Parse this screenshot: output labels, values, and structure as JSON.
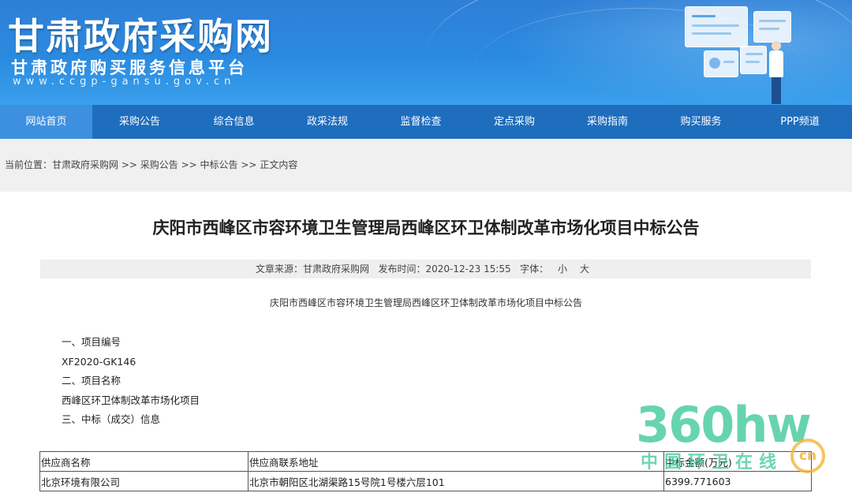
{
  "header": {
    "title": "甘肃政府采购网",
    "subtitle": "甘肃政府购买服务信息平台",
    "url": "www.ccgp-gansu.gov.cn"
  },
  "nav": {
    "items": [
      {
        "label": "网站首页",
        "active": true
      },
      {
        "label": "采购公告"
      },
      {
        "label": "综合信息"
      },
      {
        "label": "政采法规"
      },
      {
        "label": "监督检查"
      },
      {
        "label": "定点采购"
      },
      {
        "label": "采购指南"
      },
      {
        "label": "购买服务"
      },
      {
        "label": "PPP频道"
      }
    ]
  },
  "breadcrumb": {
    "prefix": "当前位置：",
    "items": [
      "甘肃政府采购网",
      "采购公告",
      "中标公告",
      "正文内容"
    ],
    "separator": " >> "
  },
  "article": {
    "title": "庆阳市西峰区市容环境卫生管理局西峰区环卫体制改革市场化项目中标公告",
    "meta": {
      "source_label": "文章来源：",
      "source": "甘肃政府采购网",
      "published_label": "发布时间：",
      "published": "2020-12-23 15:55",
      "font_label": "字体：",
      "font_small": "小",
      "font_large": "大"
    },
    "sub_heading": "庆阳市西峰区市容环境卫生管理局西峰区环卫体制改革市场化项目中标公告",
    "lines": [
      "一、项目编号",
      "XF2020-GK146",
      "二、项目名称",
      "西峰区环卫体制改革市场化项目",
      "三、中标（成交）信息"
    ],
    "table": {
      "headers": [
        "供应商名称",
        "供应商联系地址",
        "中标金额(万元)"
      ],
      "rows": [
        [
          "北京环境有限公司",
          "北京市朝阳区北湖渠路15号院1号楼六层101",
          "6399.771603"
        ]
      ]
    }
  },
  "watermark": {
    "big": "360hw",
    "small": "中国环卫在线",
    "badge": "cn"
  },
  "colors": {
    "nav_bg": "#1f6dbd",
    "nav_active": "#3d8fe0",
    "banner": "#2a8ae0"
  }
}
